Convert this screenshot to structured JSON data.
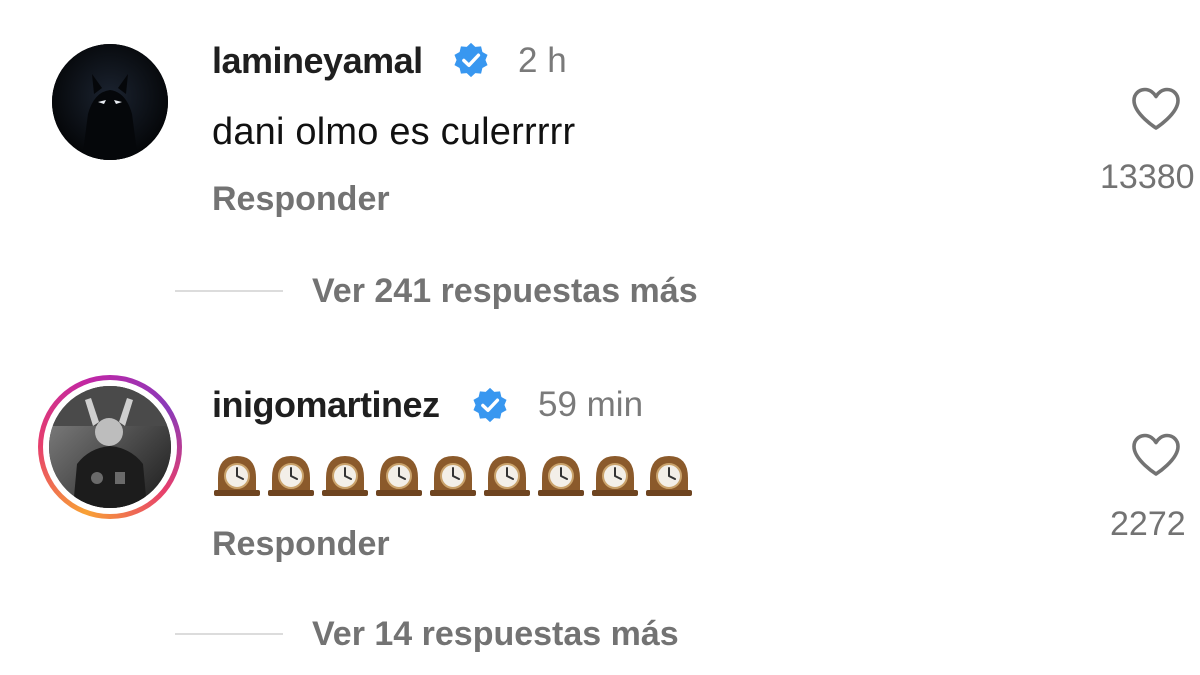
{
  "comments": [
    {
      "username": "lamineyamal",
      "time": "2 h",
      "text": "dani olmo es culerrrrr",
      "reply_label": "Responder",
      "more_replies": "Ver 241 respuestas más",
      "likes": "13380",
      "verified": true
    },
    {
      "username": "inigomartinez",
      "time": "59 min",
      "text": "🕰🕰🕰🕰🕰🕰🕰🕰🕰",
      "reply_label": "Responder",
      "more_replies": "Ver 14 respuestas más",
      "likes": "2272",
      "verified": true
    }
  ],
  "colors": {
    "verified_blue": "#3897f0",
    "secondary_text": "#737373",
    "story_ring": [
      "#f8a135",
      "#e63e6d",
      "#c026a6"
    ]
  },
  "icons": [
    "verified-badge-icon",
    "heart-icon",
    "mantel-clock-emoji"
  ]
}
